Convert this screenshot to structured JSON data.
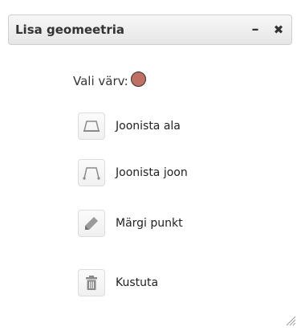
{
  "dialog": {
    "title": "Lisa geomeetria",
    "minimize_label": "–",
    "close_label": "✖"
  },
  "color": {
    "label": "Vali värv:",
    "value": "#c07060"
  },
  "tools": [
    {
      "label": "Joonista ala",
      "icon": "polygon-icon"
    },
    {
      "label": "Joonista joon",
      "icon": "line-icon"
    },
    {
      "label": "Märgi punkt",
      "icon": "pencil-icon"
    },
    {
      "label": "Kustuta",
      "icon": "trash-icon"
    }
  ],
  "colors": {
    "icon_gray": "#8a8a8a",
    "text": "#222222",
    "header_text": "#333333"
  }
}
